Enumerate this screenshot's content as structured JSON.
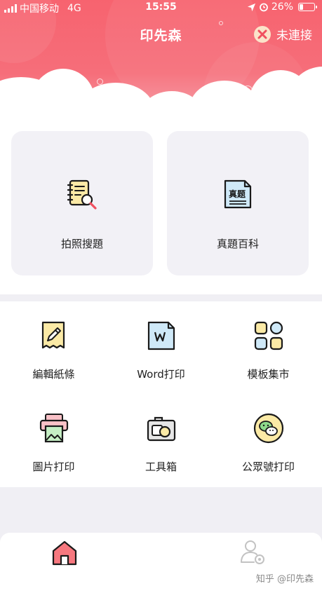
{
  "status_bar": {
    "carrier": "中国移动",
    "network": "4G",
    "time": "15:55",
    "battery": "26%",
    "battery_level": 0.26
  },
  "header": {
    "title": "印先森",
    "connection_status": "未連接"
  },
  "feature_cards": [
    {
      "label": "拍照搜題",
      "icon": "notebook-search-icon"
    },
    {
      "label": "真題百科",
      "icon": "exam-paper-icon",
      "icon_text": "真题"
    }
  ],
  "grid_items": [
    {
      "label": "編輯紙條",
      "icon": "pencil-note-icon"
    },
    {
      "label": "Word打印",
      "icon": "word-document-icon"
    },
    {
      "label": "模板集市",
      "icon": "template-grid-icon"
    },
    {
      "label": "圖片打印",
      "icon": "photo-printer-icon"
    },
    {
      "label": "工具箱",
      "icon": "toolbox-icon"
    },
    {
      "label": "公眾號打印",
      "icon": "wechat-icon"
    }
  ],
  "tab_bar": {
    "items": [
      {
        "name": "home",
        "icon": "home-icon",
        "active": true
      },
      {
        "name": "profile",
        "icon": "user-settings-icon",
        "active": false
      }
    ]
  },
  "watermark": "知乎 @印先森",
  "colors": {
    "header": "#f7636f",
    "accent_red": "#f0505f",
    "icon_yellow": "#fbeaa6",
    "icon_blue": "#cfe9f8",
    "icon_green": "#c6f0c5",
    "icon_pink": "#f9c1c7"
  }
}
